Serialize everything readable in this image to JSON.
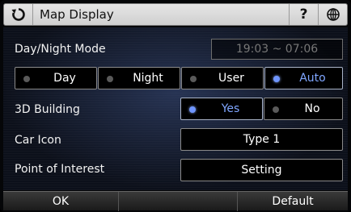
{
  "titlebar": {
    "title": "Map Display",
    "help_label": "?"
  },
  "day_night": {
    "label": "Day/Night Mode",
    "time_range": "19:03 ~ 07:06",
    "options": [
      {
        "label": "Day",
        "selected": false
      },
      {
        "label": "Night",
        "selected": false
      },
      {
        "label": "User",
        "selected": false
      },
      {
        "label": "Auto",
        "selected": true
      }
    ]
  },
  "building_3d": {
    "label": "3D Building",
    "options": [
      {
        "label": "Yes",
        "selected": true
      },
      {
        "label": "No",
        "selected": false
      }
    ]
  },
  "car_icon": {
    "label": "Car Icon",
    "value": "Type 1"
  },
  "poi": {
    "label": "Point of Interest",
    "button": "Setting"
  },
  "footer": {
    "ok_label": "OK",
    "default_label": "Default"
  },
  "colors": {
    "selected_accent": "#7fa6ff",
    "titlebar_bg": "#dcdcdc"
  }
}
